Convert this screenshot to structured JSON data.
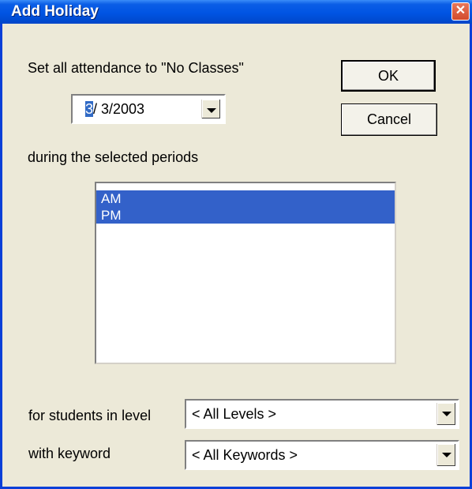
{
  "window": {
    "title": "Add Holiday",
    "accent_color": "#0054e3",
    "close_icon": "close-icon"
  },
  "instruction": "Set all attendance to \"No Classes\"",
  "date_picker": {
    "selected_part": "3",
    "rest": "/  3/2003"
  },
  "buttons": {
    "ok_label": "OK",
    "cancel_label": "Cancel"
  },
  "periods_label": "during the selected periods",
  "periods": [
    {
      "label": "AM",
      "selected": true
    },
    {
      "label": "PM",
      "selected": true
    }
  ],
  "level": {
    "label": "for students in level",
    "value": "< All Levels >"
  },
  "keyword": {
    "label": "with keyword",
    "value": "< All Keywords >"
  }
}
